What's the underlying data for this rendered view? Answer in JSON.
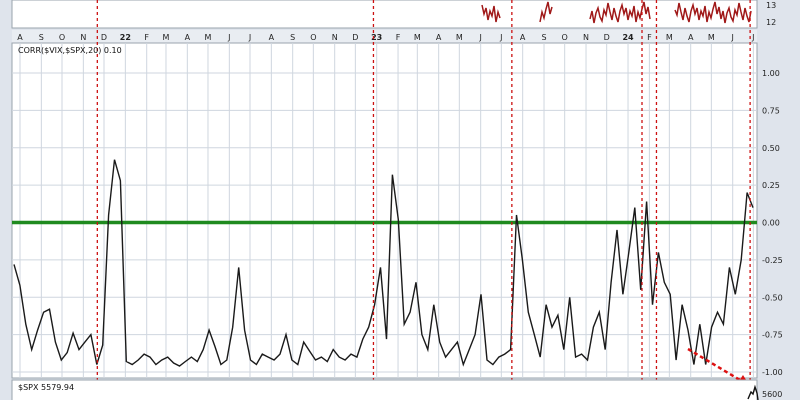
{
  "legends": {
    "corr": "CORR($VIX,$SPX,20) 0.10",
    "spx": "$SPX 5579.94"
  },
  "top_panel_ticks": [
    "13",
    "12"
  ],
  "bottom_panel_tick": "5600",
  "month_labels": [
    "A",
    "S",
    "O",
    "N",
    "D",
    "22",
    "F",
    "M",
    "A",
    "M",
    "J",
    "J",
    "A",
    "S",
    "O",
    "N",
    "D",
    "23",
    "F",
    "M",
    "A",
    "M",
    "J",
    "J",
    "A",
    "S",
    "O",
    "N",
    "D",
    "24",
    "F",
    "M",
    "A",
    "M",
    "J",
    "J"
  ],
  "colors": {
    "corr_line": "#1a1a1a",
    "zero_line": "#1f8a1f",
    "event_lines": "#cc1111",
    "top_series": "#a01818",
    "grid": "#cfd6df",
    "panel_bg": "#ffffff",
    "frame_bg": "#dfe4ec"
  },
  "chart_data": {
    "type": "line",
    "series": [
      {
        "name": "CORR($VIX,$SPX,20)",
        "last_value": 0.1,
        "values": [
          -0.28,
          -0.42,
          -0.68,
          -0.85,
          -0.72,
          -0.6,
          -0.58,
          -0.8,
          -0.92,
          -0.87,
          -0.74,
          -0.85,
          -0.8,
          -0.75,
          -0.95,
          -0.82,
          0.05,
          0.42,
          0.28,
          -0.93,
          -0.95,
          -0.92,
          -0.88,
          -0.9,
          -0.95,
          -0.92,
          -0.9,
          -0.94,
          -0.96,
          -0.93,
          -0.9,
          -0.93,
          -0.85,
          -0.72,
          -0.83,
          -0.95,
          -0.92,
          -0.7,
          -0.3,
          -0.72,
          -0.92,
          -0.95,
          -0.88,
          -0.9,
          -0.92,
          -0.88,
          -0.75,
          -0.92,
          -0.95,
          -0.8,
          -0.86,
          -0.92,
          -0.9,
          -0.93,
          -0.85,
          -0.9,
          -0.92,
          -0.88,
          -0.9,
          -0.78,
          -0.7,
          -0.55,
          -0.3,
          -0.78,
          0.32,
          0.02,
          -0.68,
          -0.6,
          -0.4,
          -0.75,
          -0.85,
          -0.55,
          -0.8,
          -0.9,
          -0.85,
          -0.8,
          -0.95,
          -0.85,
          -0.75,
          -0.48,
          -0.92,
          -0.95,
          -0.9,
          -0.88,
          -0.85,
          0.05,
          -0.25,
          -0.6,
          -0.75,
          -0.9,
          -0.55,
          -0.7,
          -0.62,
          -0.85,
          -0.5,
          -0.9,
          -0.88,
          -0.92,
          -0.7,
          -0.6,
          -0.85,
          -0.4,
          -0.05,
          -0.48,
          -0.2,
          0.1,
          -0.45,
          0.14,
          -0.55,
          -0.2,
          -0.4,
          -0.48,
          -0.92,
          -0.55,
          -0.72,
          -0.95,
          -0.68,
          -0.95,
          -0.7,
          -0.6,
          -0.68,
          -0.3,
          -0.48,
          -0.25,
          0.2,
          0.1
        ],
        "x_range": [
          "2021-08",
          "2024-07"
        ]
      }
    ],
    "ylim": [
      -1.0,
      1.0
    ],
    "yticks": [
      "1.00",
      "0.75",
      "0.50",
      "0.25",
      "0.00",
      "-0.25",
      "-0.50",
      "-0.75",
      "-1.00"
    ],
    "ytick_values": [
      1.0,
      0.75,
      0.5,
      0.25,
      0.0,
      -0.25,
      -0.5,
      -0.75,
      -1.0
    ],
    "reference_line": 0.0,
    "event_markers": [
      "2021-11-30",
      "2023-01-05",
      "2023-07-25",
      "2024-01-30",
      "2024-02-20",
      "2024-07-05"
    ],
    "grid": true,
    "legend": "top-left"
  }
}
